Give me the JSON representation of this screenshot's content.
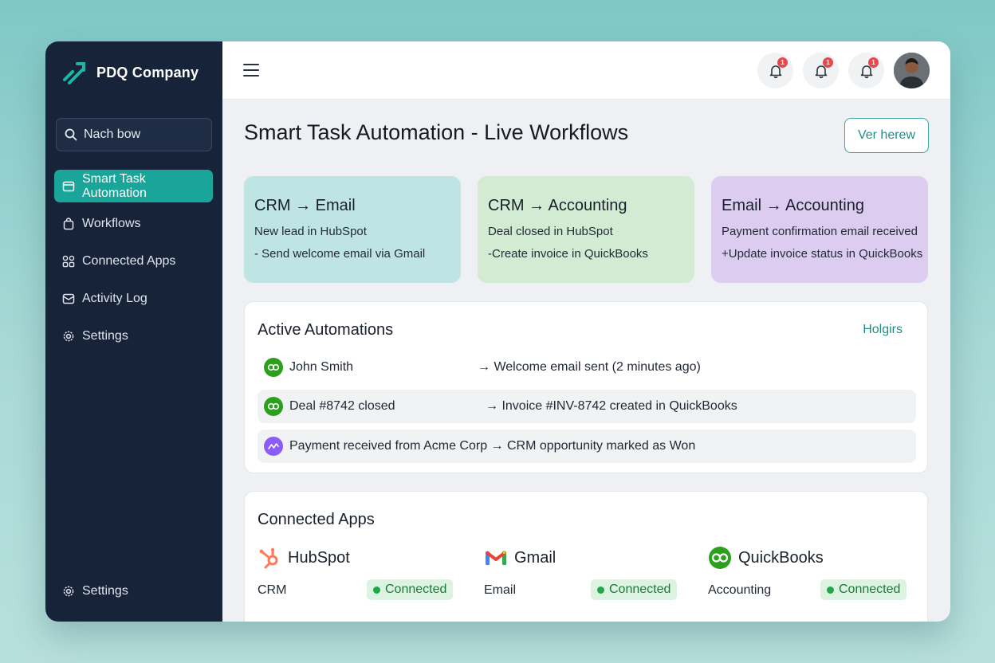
{
  "brand": {
    "name": "PDQ Company"
  },
  "search": {
    "placeholder": "Nach bow"
  },
  "sidebar": {
    "items": [
      {
        "label": "Smart Task Automation",
        "icon": "window-icon",
        "active": true
      },
      {
        "label": "Workflows",
        "icon": "bag-icon"
      },
      {
        "label": "Connected Apps",
        "icon": "grid-icon"
      },
      {
        "label": "Activity Log",
        "icon": "inbox-icon"
      },
      {
        "label": "Settings",
        "icon": "gear-icon"
      }
    ],
    "bottom": {
      "label": "Settings",
      "icon": "gear-icon"
    }
  },
  "topbar": {
    "notifications": [
      {
        "count": "1",
        "icon": "bell-icon"
      },
      {
        "count": "1",
        "icon": "bell-icon"
      },
      {
        "count": "1",
        "icon": "bell-icon"
      }
    ]
  },
  "page": {
    "title": "Smart Task Automation - Live Workflows",
    "view_button": "Ver herew"
  },
  "workflow_cards": [
    {
      "title": "CRM → Email",
      "trigger": "New lead in HubSpot",
      "action": "- Send welcome email via Gmail",
      "color": "#bfe4e4"
    },
    {
      "title": "CRM → Accounting",
      "trigger": "Deal closed in HubSpot",
      "action": "-Create invoice in QuickBooks",
      "color": "#d3ebd3"
    },
    {
      "title": "Email → Accounting",
      "trigger": "Payment confirmation email received",
      "action": "+Update invoice status in QuickBooks",
      "color": "#dccdf0"
    }
  ],
  "automations": {
    "title": "Active Automations",
    "link": "Holgirs",
    "rows": [
      {
        "left": "John Smith",
        "right": "→ Welcome email sent (2 minutes ago)",
        "icon": "quickbooks-icon"
      },
      {
        "left": "Deal #8742 closed",
        "right": "→ Invoice #INV-8742 created in QuickBooks",
        "icon": "quickbooks-icon"
      },
      {
        "left": "Payment received from Acme Corp → CRM opportunity marked as Won",
        "right": "",
        "icon": "activity-icon"
      }
    ]
  },
  "apps": {
    "title": "Connected Apps",
    "items": [
      {
        "name": "HubSpot",
        "category": "CRM",
        "status": "Connected",
        "icon": "hubspot-icon"
      },
      {
        "name": "Gmail",
        "category": "Email",
        "status": "Connected",
        "icon": "gmail-icon"
      },
      {
        "name": "QuickBooks",
        "category": "Accounting",
        "status": "Connected",
        "icon": "quickbooks-icon"
      }
    ]
  },
  "colors": {
    "sidebar": "#162338",
    "accent": "#1aa59b",
    "badge": "#e5484d",
    "connected": "#1faa4a"
  }
}
